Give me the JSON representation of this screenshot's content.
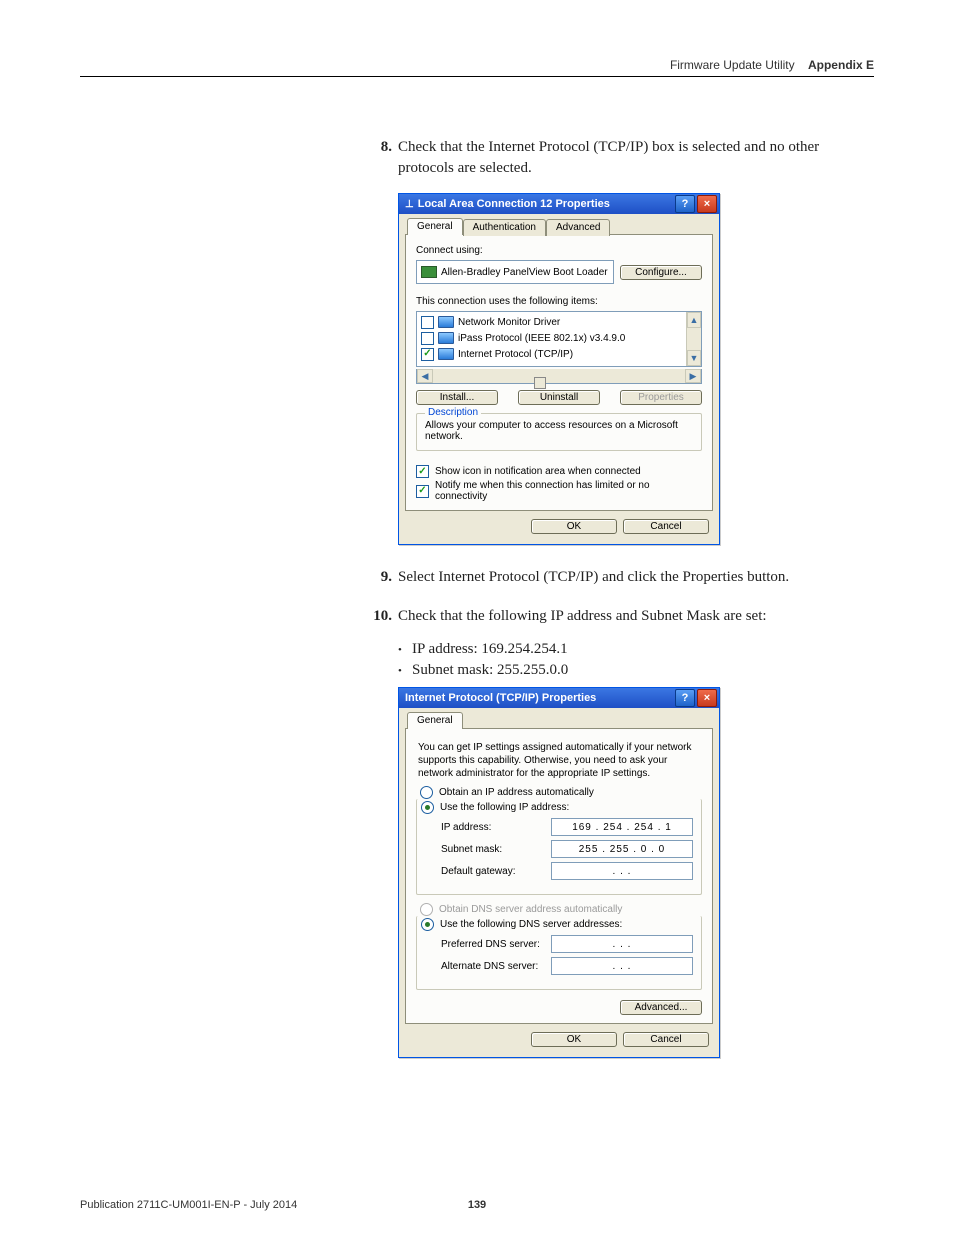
{
  "header": {
    "section": "Firmware Update Utility",
    "appendix": "Appendix E"
  },
  "steps": {
    "s8": {
      "num": "8.",
      "text": "Check that the Internet Protocol (TCP/IP) box is selected and no other protocols are selected."
    },
    "s9": {
      "num": "9.",
      "text": "Select Internet Protocol (TCP/IP) and click the Properties button."
    },
    "s10": {
      "num": "10.",
      "text": "Check that the following IP address and Subnet Mask are set:"
    }
  },
  "bullets": {
    "ip": "IP address: 169.254.254.1",
    "subnet": "Subnet mask: 255.255.0.0"
  },
  "dialog1": {
    "title": "Local Area Connection 12 Properties",
    "tabs": {
      "general": "General",
      "auth": "Authentication",
      "adv": "Advanced"
    },
    "connect_using_label": "Connect using:",
    "adapter": "Allen-Bradley PanelView Boot Loader",
    "configure_btn": "Configure...",
    "items_label": "This connection uses the following items:",
    "items": {
      "i0": "Network Monitor Driver",
      "i1": "iPass Protocol (IEEE 802.1x) v3.4.9.0",
      "i2": "Internet Protocol (TCP/IP)"
    },
    "install_btn": "Install...",
    "uninstall_btn": "Uninstall",
    "properties_btn": "Properties",
    "desc_legend": "Description",
    "desc_text": "Allows your computer to access resources on a Microsoft network.",
    "cb_show_icon": "Show icon in notification area when connected",
    "cb_notify": "Notify me when this connection has limited or no connectivity",
    "ok_btn": "OK",
    "cancel_btn": "Cancel"
  },
  "dialog2": {
    "title": "Internet Protocol (TCP/IP) Properties",
    "tab_general": "General",
    "intro": "You can get IP settings assigned automatically if your network supports this capability. Otherwise, you need to ask your network administrator for the appropriate IP settings.",
    "r_auto_ip": "Obtain an IP address automatically",
    "r_use_ip": "Use the following IP address:",
    "lbl_ip": "IP address:",
    "val_ip": "169 . 254 . 254 .   1",
    "lbl_subnet": "Subnet mask:",
    "val_subnet": "255 . 255 .   0  .   0",
    "lbl_gateway": "Default gateway:",
    "val_gateway": ".        .        .",
    "r_auto_dns": "Obtain DNS server address automatically",
    "r_use_dns": "Use the following DNS server addresses:",
    "lbl_pref_dns": "Preferred DNS server:",
    "val_pref_dns": ".        .        .",
    "lbl_alt_dns": "Alternate DNS server:",
    "val_alt_dns": ".        .        .",
    "advanced_btn": "Advanced...",
    "ok_btn": "OK",
    "cancel_btn": "Cancel"
  },
  "footer": {
    "pub": "Publication 2711C-UM001I-EN-P - July 2014",
    "page": "139"
  }
}
